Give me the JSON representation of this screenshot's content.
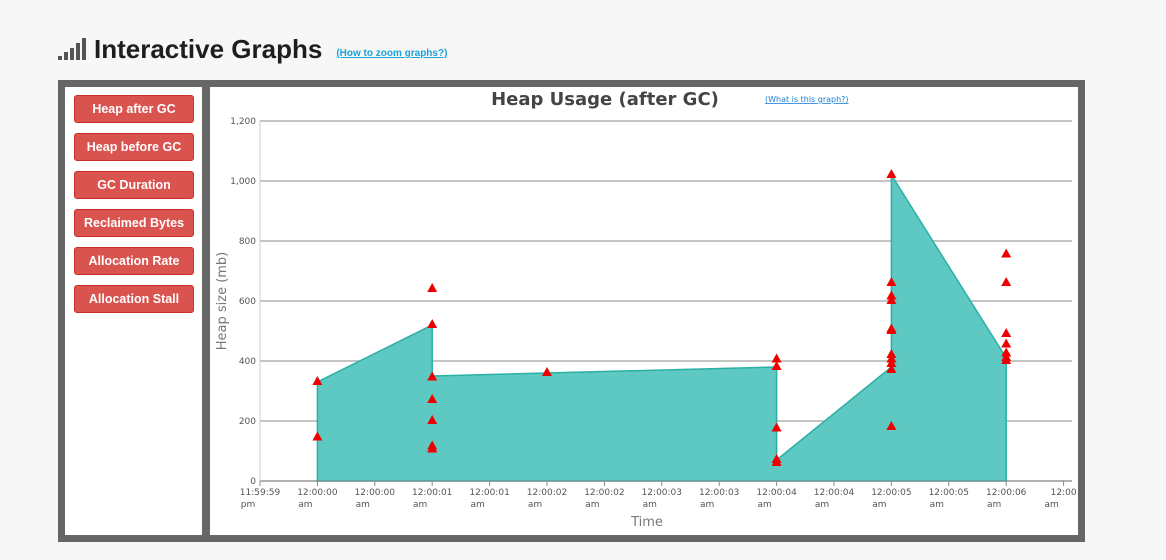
{
  "header": {
    "title": "Interactive Graphs",
    "zoom_link": "(How to zoom graphs?)"
  },
  "sidebar": {
    "buttons": [
      {
        "label": "Heap after GC"
      },
      {
        "label": "Heap before GC"
      },
      {
        "label": "GC Duration"
      },
      {
        "label": "Reclaimed Bytes"
      },
      {
        "label": "Allocation Rate"
      },
      {
        "label": "Allocation Stall"
      }
    ]
  },
  "colors": {
    "area_fill": "#5ec8c2",
    "area_line": "#2bb0a6",
    "marker": "#ee0000",
    "button": "#d9534f"
  },
  "chart_data": {
    "type": "area",
    "title": "Heap Usage (after GC)",
    "help_link": "(What is this graph?)",
    "xlabel": "Time",
    "ylabel": "Heap size (mb)",
    "ylim": [
      0,
      1200
    ],
    "y_ticks": [
      "0",
      "200",
      "400",
      "600",
      "800",
      "1,000",
      "1,200"
    ],
    "grid": true,
    "x_tick_labels": [
      [
        "11:59:59",
        "pm"
      ],
      [
        "12:00:00",
        "am"
      ],
      [
        "12:00:00",
        "am"
      ],
      [
        "12:00:01",
        "am"
      ],
      [
        "12:00:01",
        "am"
      ],
      [
        "12:00:02",
        "am"
      ],
      [
        "12:00:02",
        "am"
      ],
      [
        "12:00:03",
        "am"
      ],
      [
        "12:00:03",
        "am"
      ],
      [
        "12:00:04",
        "am"
      ],
      [
        "12:00:04",
        "am"
      ],
      [
        "12:00:05",
        "am"
      ],
      [
        "12:00:05",
        "am"
      ],
      [
        "12:00:06",
        "am"
      ],
      [
        "12:00",
        "am"
      ]
    ],
    "area_series": [
      {
        "tick": 1,
        "y": 0
      },
      {
        "tick": 1,
        "y": 330
      },
      {
        "tick": 3,
        "y": 520
      },
      {
        "tick": 3,
        "y": 350
      },
      {
        "tick": 9,
        "y": 380
      },
      {
        "tick": 9,
        "y": 70
      },
      {
        "tick": 11,
        "y": 380
      },
      {
        "tick": 11,
        "y": 1020
      },
      {
        "tick": 13,
        "y": 410
      },
      {
        "tick": 13,
        "y": 0
      }
    ],
    "markers": [
      {
        "tick": 1,
        "y": 330
      },
      {
        "tick": 1,
        "y": 145
      },
      {
        "tick": 3,
        "y": 640
      },
      {
        "tick": 3,
        "y": 520
      },
      {
        "tick": 3,
        "y": 345
      },
      {
        "tick": 3,
        "y": 270
      },
      {
        "tick": 3,
        "y": 200
      },
      {
        "tick": 3,
        "y": 115
      },
      {
        "tick": 3,
        "y": 105
      },
      {
        "tick": 5,
        "y": 360
      },
      {
        "tick": 9,
        "y": 405
      },
      {
        "tick": 9,
        "y": 380
      },
      {
        "tick": 9,
        "y": 175
      },
      {
        "tick": 9,
        "y": 70
      },
      {
        "tick": 9,
        "y": 60
      },
      {
        "tick": 11,
        "y": 1020
      },
      {
        "tick": 11,
        "y": 660
      },
      {
        "tick": 11,
        "y": 615
      },
      {
        "tick": 11,
        "y": 600
      },
      {
        "tick": 11,
        "y": 505
      },
      {
        "tick": 11,
        "y": 500
      },
      {
        "tick": 11,
        "y": 420
      },
      {
        "tick": 11,
        "y": 405
      },
      {
        "tick": 11,
        "y": 390
      },
      {
        "tick": 11,
        "y": 370
      },
      {
        "tick": 11,
        "y": 180
      },
      {
        "tick": 13,
        "y": 755
      },
      {
        "tick": 13,
        "y": 660
      },
      {
        "tick": 13,
        "y": 490
      },
      {
        "tick": 13,
        "y": 455
      },
      {
        "tick": 13,
        "y": 425
      },
      {
        "tick": 13,
        "y": 410
      },
      {
        "tick": 13,
        "y": 400
      }
    ]
  }
}
